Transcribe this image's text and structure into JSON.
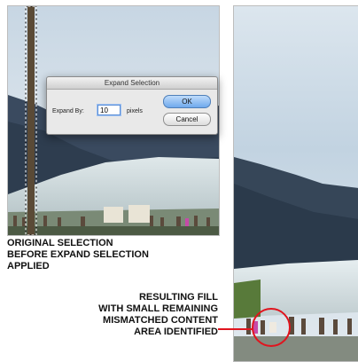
{
  "dialog": {
    "title": "Expand Selection",
    "expand_label": "Expand By:",
    "expand_value": "10",
    "unit_label": "pixels",
    "ok_label": "OK",
    "cancel_label": "Cancel"
  },
  "captions": {
    "left": [
      "ORIGINAL SELECTION",
      "BEFORE EXPAND SELECTION",
      "APPLIED"
    ],
    "right": [
      "RESULTING FILL",
      "WITH SMALL REMAINING",
      "MISMATCHED CONTENT",
      "AREA IDENTIFIED"
    ]
  },
  "colors": {
    "highlight_red": "#e0141e",
    "ok_blue": "#6fa9ec"
  },
  "icons": {
    "selection_marquee": "marching-ants"
  }
}
